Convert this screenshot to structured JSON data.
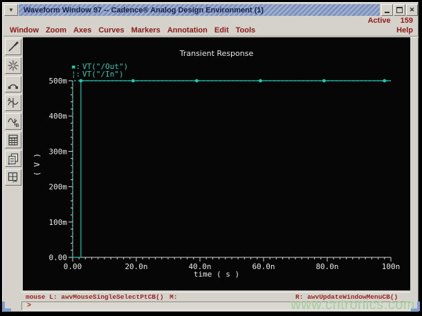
{
  "window": {
    "title": "Waveform Window 97 -- Cadence® Analog Design Environment (1)",
    "controls": [
      "minimize-icon",
      "maximize-icon",
      "close-icon"
    ],
    "menu_button_icon": "chevron-down-icon",
    "active_label": "Active",
    "active_count": "159"
  },
  "menu": {
    "items": [
      "Window",
      "Zoom",
      "Axes",
      "Curves",
      "Markers",
      "Annotation",
      "Edit",
      "Tools"
    ],
    "help": "Help"
  },
  "toolbar": {
    "icons": [
      "probe-icon",
      "zoom-fit-icon",
      "trace-arc-icon",
      "vertical-marker-icon",
      "point-marker-b-icon",
      "calculator-icon",
      "copy-window-icon",
      "cut-window-icon"
    ]
  },
  "plot": {
    "title": "Transient Response",
    "legend": [
      {
        "marker": "▪:",
        "label": "VT(\"/Out\")"
      },
      {
        "marker": "¦:",
        "label": "VT(\"/In\")"
      }
    ],
    "ylabel": "( V )",
    "xlabel": "time ( s )"
  },
  "status": {
    "left_binding": "mouse L: awvMouseSingleSelectPtCB()",
    "middle_binding": "M:",
    "right_binding": "R: awvUpdateWindowMenuCB()",
    "prompt": ">"
  },
  "watermark": "www.cntronics.com",
  "colors": {
    "trace_teal": "#20c8b4",
    "axis_gray": "#d9d9d9",
    "plot_text": "#e8e8e8",
    "menu_red": "#8c1a16",
    "status_red": "#9b2420",
    "titlebar_blue": "#7e92bc",
    "watermark_green": "#a0d29a",
    "chrome_gray": "#d5d2cb",
    "plot_bg": "#060606"
  },
  "chart_data": {
    "type": "line",
    "title": "Transient Response",
    "xlabel": "time ( s )",
    "ylabel": "( V )",
    "x_unit": "ns",
    "y_unit": "V",
    "xlim": [
      0,
      100
    ],
    "ylim": [
      0,
      0.5
    ],
    "grid": false,
    "legend_position": "top-left",
    "xticks": {
      "values": [
        0,
        20,
        40,
        60,
        80,
        100
      ],
      "labels": [
        "0.00",
        "20.0n",
        "40.0n",
        "60.0n",
        "80.0n",
        "100n"
      ]
    },
    "yticks": {
      "values": [
        0,
        0.1,
        0.2,
        0.3,
        0.4,
        0.5
      ],
      "labels": [
        "0.00",
        "100m",
        "200m",
        "300m",
        "400m",
        "500m"
      ]
    },
    "x_minor_step": 2,
    "y_minor_step": 0.02,
    "series": [
      {
        "name": "VT(\"/Out\")",
        "line": "solid",
        "x": [
          0,
          2.6,
          2.6,
          100
        ],
        "y": [
          0,
          0,
          0.5,
          0.5
        ],
        "marker": "dot",
        "marker_x": [
          2.6,
          19,
          39,
          59,
          79,
          98
        ],
        "marker_y": [
          0.5,
          0.5,
          0.5,
          0.5,
          0.5,
          0.5
        ]
      },
      {
        "name": "VT(\"/In\")",
        "line": "dashed",
        "x": [
          0,
          0,
          100
        ],
        "y": [
          0,
          0.5,
          0.5
        ]
      }
    ]
  }
}
